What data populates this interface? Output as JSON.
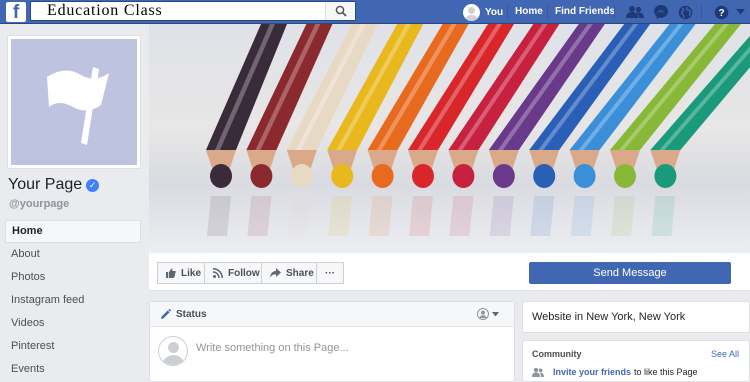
{
  "topbar": {
    "logo": "f",
    "search_value": "Education Class",
    "user_label": "You",
    "links": [
      "Home",
      "Find Friends"
    ],
    "icons": [
      "friends-icon",
      "messenger-icon",
      "globe-icon",
      "help-icon",
      "caret-down-icon"
    ]
  },
  "page": {
    "name": "Your Page",
    "handle": "@yourpage"
  },
  "sidebar": {
    "items": [
      {
        "label": "Home",
        "active": true
      },
      {
        "label": "About"
      },
      {
        "label": "Photos"
      },
      {
        "label": "Instagram feed"
      },
      {
        "label": "Videos"
      },
      {
        "label": "Pinterest"
      },
      {
        "label": "Events"
      }
    ]
  },
  "cover": {
    "pencil_colors": [
      "#3a2b3a",
      "#8b2a2e",
      "#e8d9c4",
      "#e8b81c",
      "#e86a1f",
      "#d8262b",
      "#c8203f",
      "#6a3a8a",
      "#2a5fb8",
      "#3a8fd8",
      "#88b838",
      "#1a9a7a"
    ]
  },
  "actions": {
    "like": "Like",
    "follow": "Follow",
    "share": "Share",
    "more": "···",
    "send_message": "Send Message"
  },
  "status": {
    "label": "Status",
    "placeholder": "Write something on this Page..."
  },
  "website": {
    "text": "Website in New York, New York"
  },
  "community": {
    "title": "Community",
    "see_all": "See All",
    "invite_link": "Invite your friends",
    "invite_text": "to like this Page"
  },
  "colors": {
    "brand": "#4267b2",
    "background": "#e9ebee",
    "placeholder_bg": "#bec3e0"
  }
}
